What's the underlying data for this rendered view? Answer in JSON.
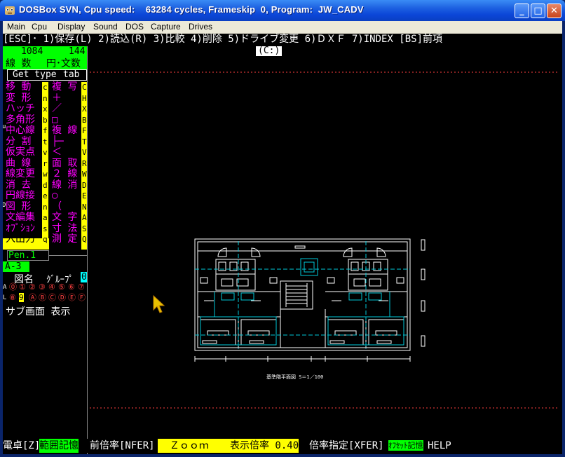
{
  "window": {
    "title": "DOSBox SVN, Cpu speed:    63284 cycles, Frameskip  0, Program:  JW_CADV",
    "controls": {
      "minimize": "_",
      "maximize": "□",
      "close": "✕"
    }
  },
  "menu": [
    "Main",
    "Cpu",
    "Display",
    "Sound",
    "DOS",
    "Capture",
    "Drives"
  ],
  "topbar": "[ESC]･ 1)保存(L) 2)読込(R) 3)比較 4)削除 5)ドライブ変更 6)ＤＸＦ 7)INDEX [BS]前項",
  "drive": "(C:)",
  "side": {
    "count_line": "1084",
    "count_circle": "144",
    "label_line": "線 数",
    "label_circle": "円･文数",
    "gettype": "Get type",
    "tab": "tab",
    "commands_left": [
      "移 動",
      "変 形",
      "ハッチ",
      "多角形",
      "中心線",
      "分 割",
      "仮実点",
      "曲 線",
      "線変更",
      "消 去",
      "円線接",
      "図 形",
      "文編集",
      "ｵﾌﾟｼｮﾝ",
      "入出力"
    ],
    "keys_left": [
      "c",
      "n",
      "x",
      "b",
      "f",
      "t",
      "v",
      "r",
      "w",
      "d",
      "e",
      "n",
      "a",
      "s",
      "q"
    ],
    "commands_right": [
      "複 写",
      "＋",
      "／",
      "□",
      "複 線",
      "├─",
      "＜",
      "面 取",
      "２ 線",
      "線 消",
      "○",
      "（",
      "文 字",
      "寸 法",
      "測 定"
    ],
    "keys_right": [
      "C",
      "H",
      "X",
      "B",
      "F",
      "T",
      "V",
      "R",
      "W",
      "D",
      "E",
      "N",
      "A",
      "S",
      "Q"
    ],
    "marks": {
      "u": "u",
      "d": "D"
    },
    "pen": "Pen.1",
    "scale": "A-3  S=1/100",
    "layer_name": "図名",
    "group": "ｸﾞﾙｰﾌﾟ",
    "group_num": "0",
    "row_a_label": "A",
    "row_l_label": "L",
    "row_a": [
      "⓪",
      "①",
      "②",
      "③",
      "④",
      "⑤",
      "⑥",
      "⑦"
    ],
    "row_l": [
      "⑧",
      "9",
      "Ⓐ",
      "Ⓑ",
      "Ⓒ",
      "Ⓓ",
      "Ⓔ",
      "Ⓕ"
    ],
    "subscreen": "サブ画面 表示"
  },
  "drawing": {
    "caption": "基準階平面図  S＝1／100"
  },
  "status": {
    "s1": "電卓[Z]",
    "s2": "範囲記憶",
    "s3": "前倍率[NFER]",
    "s4": "  Ｚｏｏｍ    ",
    "s5": "表示倍率 0.40",
    "s6": "倍率指定[XFER]",
    "s7": "ｵﾌｾｯﾄ記憶",
    "s8": "HELP"
  },
  "colors": {
    "cyan": "#00c8d8",
    "yellow": "#ffff00",
    "green": "#00ff00",
    "magenta": "#ff00ff",
    "red": "#ff4040",
    "white": "#ffffff"
  }
}
